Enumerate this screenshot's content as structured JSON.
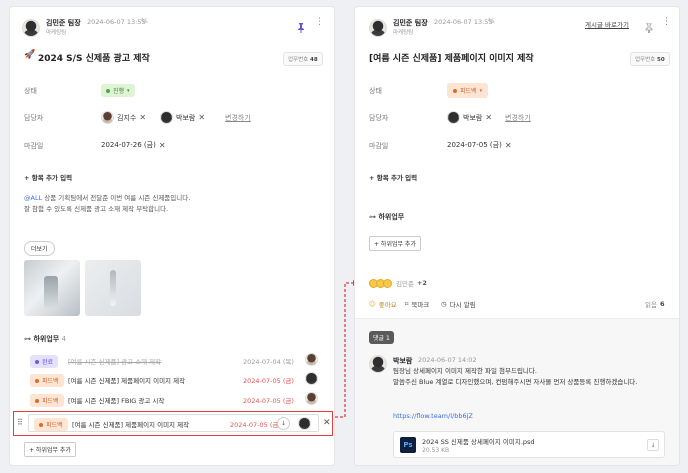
{
  "left": {
    "author": "김민준 팀장",
    "timestamp": "2024-06-07 13:55",
    "department": "마케팅팀",
    "title": "2024 S/S 신제품 광고 제작",
    "task_no_label": "업무번호",
    "task_no": "48",
    "status_label": "상태",
    "status_value": "진행",
    "assignee_label": "담당자",
    "assignees": [
      "김지수",
      "박보람"
    ],
    "change_label": "변경하기",
    "due_label": "마감일",
    "due_value": "2024-07-26 (금)",
    "add_field": "항목 추가 입력",
    "body_line1_mention": "@ALL",
    "body_line1": " 상품 기획팀에서 전달준 이번 여름 시즌 신제품입니다.",
    "body_line2": "잘 참험 수 있도록 신제품 광고 소재 제작 부탁합니다.",
    "more_button": "더보기",
    "subtasks_label": "하위업무",
    "subtasks_count": "4",
    "subtasks": [
      {
        "status": "완료",
        "title": "[여름 시즌 신제품] 광고 소재 제작",
        "date": "2024-07-04 (목)"
      },
      {
        "status": "피드백",
        "title": "[여름 시즌 신제품] 제품페이지 이미지 제작",
        "date": "2024-07-05 (금)"
      },
      {
        "status": "피드백",
        "title": "[여름 시즌 신제품] FBIG 광고 시작",
        "date": "2024-07-05 (금)"
      },
      {
        "status": "피드백",
        "title": "[여름 시즌 신제품] 제품페이지 이미지 제작",
        "date": "2024-07-05 (금)"
      }
    ],
    "add_subtask": "+ 하위업무 추가"
  },
  "right": {
    "author": "김민준 팀장",
    "timestamp": "2024-06-07 13:55",
    "department": "마케팅팀",
    "back_link": "게시글 바로가기",
    "title": "[여름 시즌 신제품] 제품페이지 이미지 제작",
    "task_no_label": "업무번호",
    "task_no": "50",
    "status_label": "상태",
    "status_value": "피드백",
    "assignee_label": "담당자",
    "assignee": "박보람",
    "change_label": "변경하기",
    "due_label": "마감일",
    "due_value": "2024-07-05 (금)",
    "add_field": "항목 추가 입력",
    "subtasks_label": "하위업무",
    "add_subtask": "+ 하위업무 추가",
    "reaction_names": "김민준",
    "reaction_more": "+2",
    "actions": [
      "좋아요",
      "북마크",
      "다시 알림"
    ],
    "read_label": "읽음",
    "read_count": "6",
    "comment_tag": "댓글 1",
    "comment_author": "박보람",
    "comment_time": "2024-06-07 14:02",
    "comment_line1": "팀장님 상세페이지 이미지 제작한 파일 첨부드립니다.",
    "comment_line2": "말씀주신 Blue 계열로 디자인했으며, 컨펌해주시면 자사몰 먼저 상품등록 진행하겠습니다.",
    "comment_link": "https://flow.team/l/bb6jZ",
    "file_name": "2024 SS 신제품 상세페이지 이미지.psd",
    "file_size": "20.53 KB",
    "file_icon_text": "Ps"
  },
  "colors": {
    "accent_purple": "#6452d8",
    "highlight_red": "#e04040",
    "link_blue": "#3a6fd9"
  }
}
